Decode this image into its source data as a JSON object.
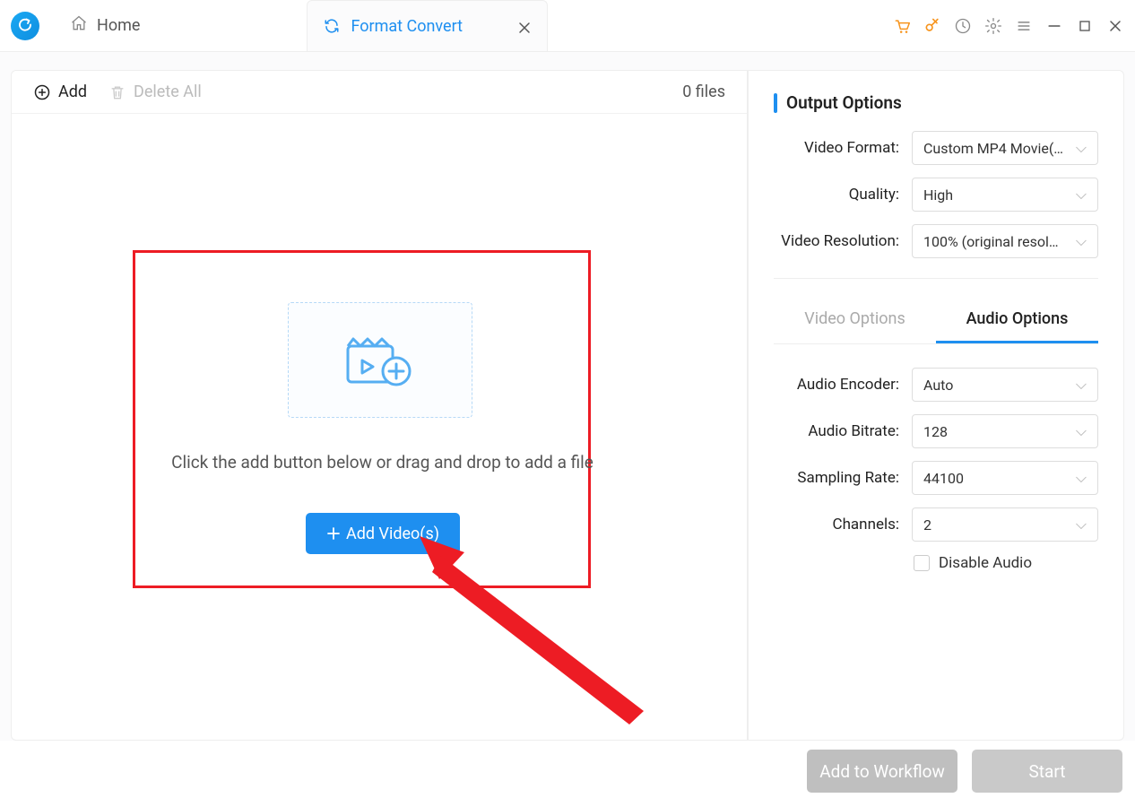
{
  "tabs": {
    "home": "Home",
    "convert": "Format Convert"
  },
  "toolbar": {
    "add": "Add",
    "delete_all": "Delete All",
    "files_count": "0 files"
  },
  "drop": {
    "hint": "Click the add button below or drag and drop to add a file",
    "add_video": "Add Video(s)"
  },
  "output": {
    "title": "Output Options",
    "labels": {
      "video_format": "Video Format:",
      "quality": "Quality:",
      "resolution": "Video Resolution:"
    },
    "values": {
      "video_format": "Custom MP4 Movie(…",
      "quality": "High",
      "resolution": "100% (original resol…"
    }
  },
  "sub": {
    "video_options": "Video Options",
    "audio_options": "Audio Options"
  },
  "audio": {
    "labels": {
      "encoder": "Audio Encoder:",
      "bitrate": "Audio Bitrate:",
      "sampling": "Sampling Rate:",
      "channels": "Channels:",
      "disable": "Disable Audio"
    },
    "values": {
      "encoder": "Auto",
      "bitrate": "128",
      "sampling": "44100",
      "channels": "2"
    }
  },
  "buttons": {
    "workflow": "Add to Workflow",
    "start": "Start"
  }
}
